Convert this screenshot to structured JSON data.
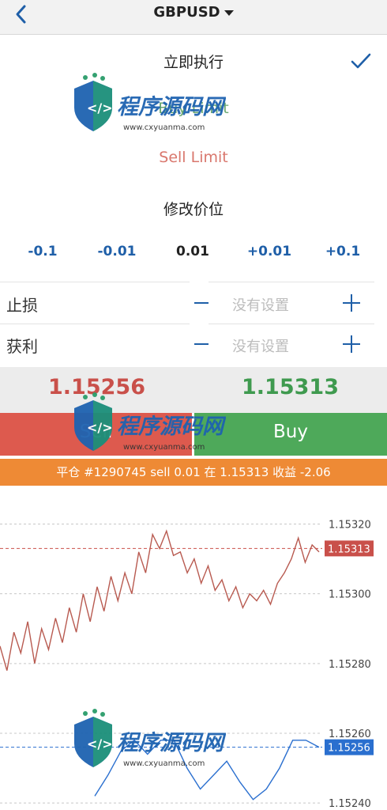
{
  "header": {
    "symbol": "GBPUSD",
    "back_icon": "chevron-left-icon",
    "dropdown_icon": "caret-down-icon"
  },
  "order_types": [
    {
      "label": "立即执行",
      "color": "#222222",
      "selected": true
    },
    {
      "label": "Buy Limit",
      "color": "#6aa86f",
      "selected": false
    },
    {
      "label": "Sell Limit",
      "color": "#d9776d",
      "selected": false
    },
    {
      "label": "修改价位",
      "color": "#222222",
      "selected": false
    }
  ],
  "volume_steps": [
    "-0.1",
    "-0.01",
    "0.01",
    "+0.01",
    "+0.1"
  ],
  "stop_loss": {
    "label": "止损",
    "value": "没有设置"
  },
  "take_profit": {
    "label": "获利",
    "value": "没有设置"
  },
  "quotes": {
    "bid": "1.15256",
    "ask": "1.15313"
  },
  "buttons": {
    "sell": "Sell",
    "buy": "Buy"
  },
  "notice": "平仓 #1290745 sell 0.01 在 1.15313 收益 -2.06",
  "watermark": {
    "line1": "程序源码网",
    "line2": "www.cxyuanma.com"
  },
  "chart_data": {
    "type": "line",
    "y_ticks": [
      "1.15320",
      "1.15300",
      "1.15280",
      "1.15260",
      "1.15240"
    ],
    "ylim": [
      1.15238,
      1.15331
    ],
    "ask_line": {
      "label": "1.15313",
      "value": 1.15313,
      "color": "#c9504a"
    },
    "bid_line": {
      "label": "1.15256",
      "value": 1.15256,
      "color": "#2a6fcf"
    },
    "grid": true,
    "series": [
      {
        "color": "#b85a50",
        "values": [
          1.15285,
          1.15278,
          1.15289,
          1.15283,
          1.15292,
          1.1528,
          1.1529,
          1.15284,
          1.15293,
          1.15286,
          1.15296,
          1.15289,
          1.153,
          1.15292,
          1.15302,
          1.15295,
          1.15305,
          1.15298,
          1.15306,
          1.153,
          1.15312,
          1.15306,
          1.15317,
          1.15313,
          1.15318,
          1.15311,
          1.15312,
          1.15306,
          1.1531,
          1.15303,
          1.15308,
          1.15301,
          1.15304,
          1.15298,
          1.15302,
          1.15296,
          1.153,
          1.15298,
          1.15301,
          1.15297,
          1.15303,
          1.15306,
          1.1531,
          1.15316,
          1.15309,
          1.15314,
          1.15312
        ]
      },
      {
        "color": "#2a6fcf",
        "values": [
          1.15242,
          1.15248,
          1.15255,
          1.15258,
          1.15254,
          1.15258,
          1.15258,
          1.1525,
          1.15244,
          1.15248,
          1.15252,
          1.15246,
          1.15241,
          1.15244,
          1.1525,
          1.15258,
          1.15258,
          1.15256
        ]
      }
    ]
  }
}
